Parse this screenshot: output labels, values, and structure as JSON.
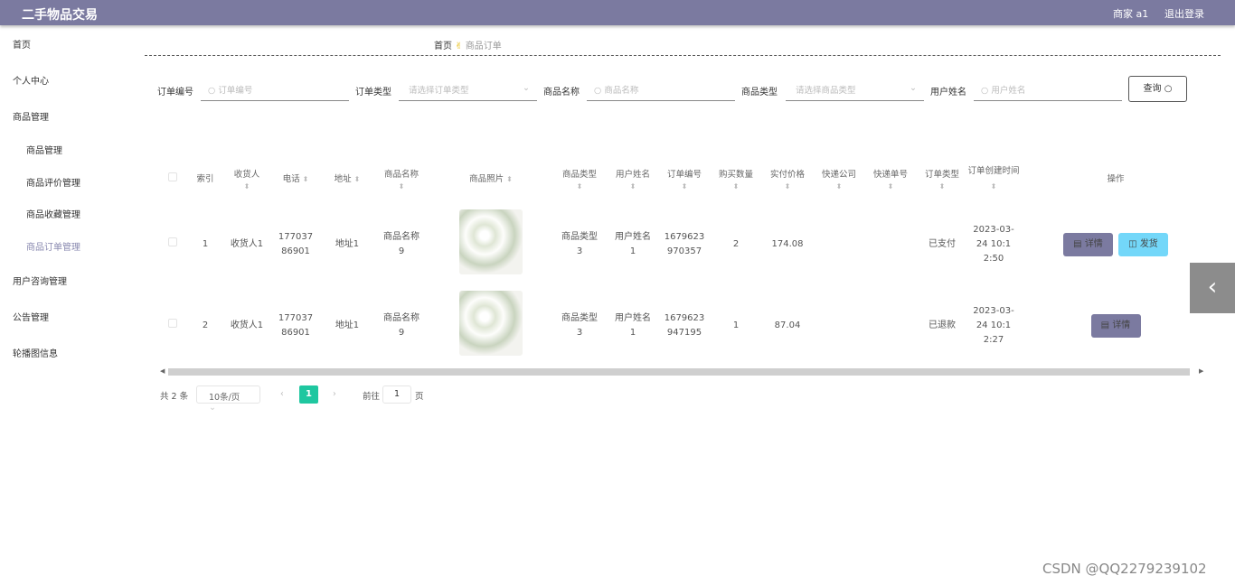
{
  "header": {
    "title": "二手物品交易",
    "user": "商家 a1",
    "logout": "退出登录"
  },
  "sidebar": {
    "items": [
      {
        "label": "首页"
      },
      {
        "label": "个人中心"
      },
      {
        "label": "商品管理"
      },
      {
        "label": "商品管理"
      },
      {
        "label": "商品评价管理"
      },
      {
        "label": "商品收藏管理"
      },
      {
        "label": "商品订单管理",
        "active": true
      },
      {
        "label": "用户咨询管理"
      },
      {
        "label": "公告管理"
      },
      {
        "label": "轮播图信息"
      }
    ]
  },
  "breadcrumb": {
    "home": "首页",
    "current": "商品订单"
  },
  "search": {
    "order_no_label": "订单编号",
    "order_no_placeholder": "订单编号",
    "order_type_label": "订单类型",
    "order_type_placeholder": "请选择订单类型",
    "goods_name_label": "商品名称",
    "goods_name_placeholder": "商品名称",
    "goods_type_label": "商品类型",
    "goods_type_placeholder": "请选择商品类型",
    "user_name_label": "用户姓名",
    "user_name_placeholder": "用户姓名",
    "query": "查询"
  },
  "table": {
    "headers": [
      "索引",
      "收货人",
      "电话",
      "地址",
      "商品名称",
      "商品照片",
      "商品类型",
      "用户姓名",
      "订单编号",
      "购买数量",
      "实付价格",
      "快递公司",
      "快递单号",
      "订单类型",
      "订单创建时间",
      "操作"
    ],
    "rows": [
      {
        "index": "1",
        "receiver": "收货人1",
        "phone": "17703786901",
        "address": "地址1",
        "goods_name": "商品名称9",
        "goods_type": "商品类型3",
        "user_name": "用户姓名1",
        "order_no": "1679623970357",
        "qty": "2",
        "price": "174.08",
        "express": "",
        "express_no": "",
        "order_type": "已支付",
        "created": "2023-03-24 10:12:50",
        "actions": [
          "详情",
          "发货"
        ]
      },
      {
        "index": "2",
        "receiver": "收货人1",
        "phone": "17703786901",
        "address": "地址1",
        "goods_name": "商品名称9",
        "goods_type": "商品类型3",
        "user_name": "用户姓名1",
        "order_no": "1679623947195",
        "qty": "1",
        "price": "87.04",
        "express": "",
        "express_no": "",
        "order_type": "已退款",
        "created": "2023-03-24 10:12:27",
        "actions": [
          "详情"
        ]
      }
    ]
  },
  "pagination": {
    "total": "共 2 条",
    "page_size": "10条/页",
    "current": "1",
    "goto_label": "前往",
    "goto_value": "1",
    "page_suffix": "页"
  },
  "watermark": "CSDN @QQ2279239102",
  "colors": {
    "header": "#7b7aa0",
    "detail_button": "#7b7aa0",
    "ship_button": "#73d7f9",
    "active_page": "#1fc7a0"
  }
}
